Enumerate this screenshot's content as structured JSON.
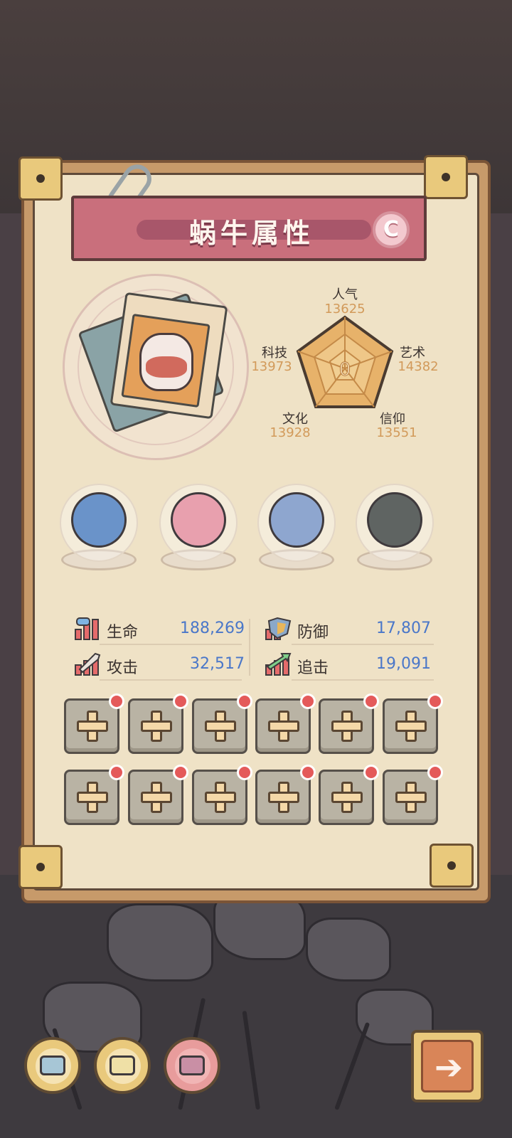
{
  "panel": {
    "title": "蜗牛属性",
    "grade": "C"
  },
  "radar": {
    "center_value": "0",
    "axes": [
      {
        "key": "popularity",
        "label": "人气",
        "value": "13625"
      },
      {
        "key": "art",
        "label": "艺术",
        "value": "14382"
      },
      {
        "key": "faith",
        "label": "信仰",
        "value": "13551"
      },
      {
        "key": "culture",
        "label": "文化",
        "value": "13928"
      },
      {
        "key": "tech",
        "label": "科技",
        "value": "13973"
      }
    ]
  },
  "relics": [
    {
      "name": "dna-relic"
    },
    {
      "name": "shell-relic"
    },
    {
      "name": "compass-relic"
    },
    {
      "name": "planet-relic"
    }
  ],
  "stats": {
    "life": {
      "label": "生命",
      "value": "188,269"
    },
    "defense": {
      "label": "防御",
      "value": "17,807"
    },
    "attack": {
      "label": "攻击",
      "value": "32,517"
    },
    "pursuit": {
      "label": "追击",
      "value": "19,091"
    }
  },
  "slots": {
    "rows": 2,
    "per_row": 6,
    "has_notification": true
  },
  "nav": {
    "next_arrow": "➔"
  },
  "colors": {
    "title_bar": "#c96f7c",
    "stat_value": "#4a77c9",
    "radar_value": "#d29a5a",
    "notify_dot": "#e45a5a"
  }
}
